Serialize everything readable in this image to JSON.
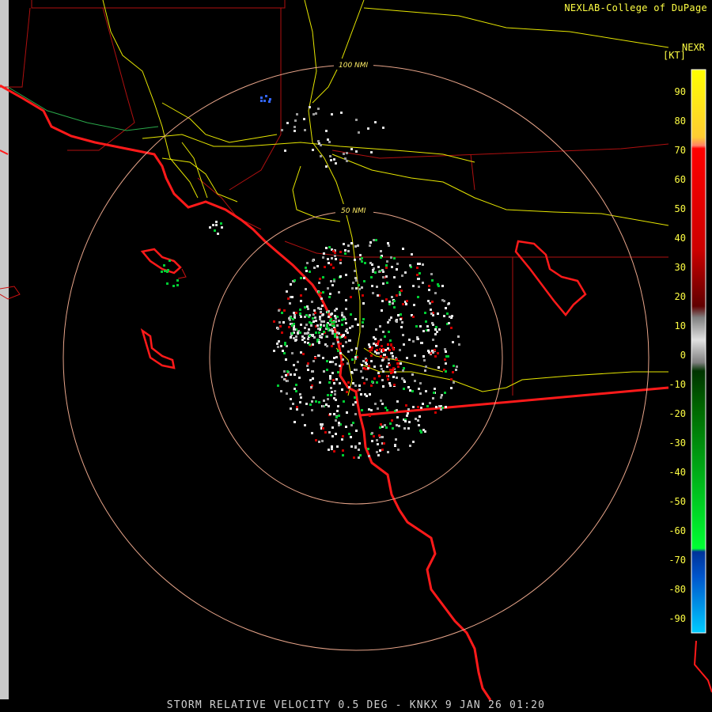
{
  "header": {
    "credit": "NEXLAB-College of DuPage",
    "legend_title": "NEXR",
    "legend_unit": "[KT]"
  },
  "footer": {
    "product": "STORM RELATIVE VELOCITY 0.5 DEG - KNKX 9 JAN 26 01:20"
  },
  "range_rings": [
    {
      "label": "50 NMI",
      "nmi": 50
    },
    {
      "label": "100 NMI",
      "nmi": 100
    }
  ],
  "legend": {
    "ticks": [
      "90",
      "80",
      "70",
      "60",
      "50",
      "40",
      "30",
      "20",
      "10",
      "0",
      "-10",
      "-20",
      "-30",
      "-40",
      "-50",
      "-60",
      "-70",
      "-80",
      "-90"
    ],
    "colors": {
      "high_inbound": "#ffff00",
      "outbound": "#ff0000",
      "near_zero": "#808080",
      "inbound": "#00cc33",
      "high_outbound_blue": "#0099ff"
    }
  }
}
